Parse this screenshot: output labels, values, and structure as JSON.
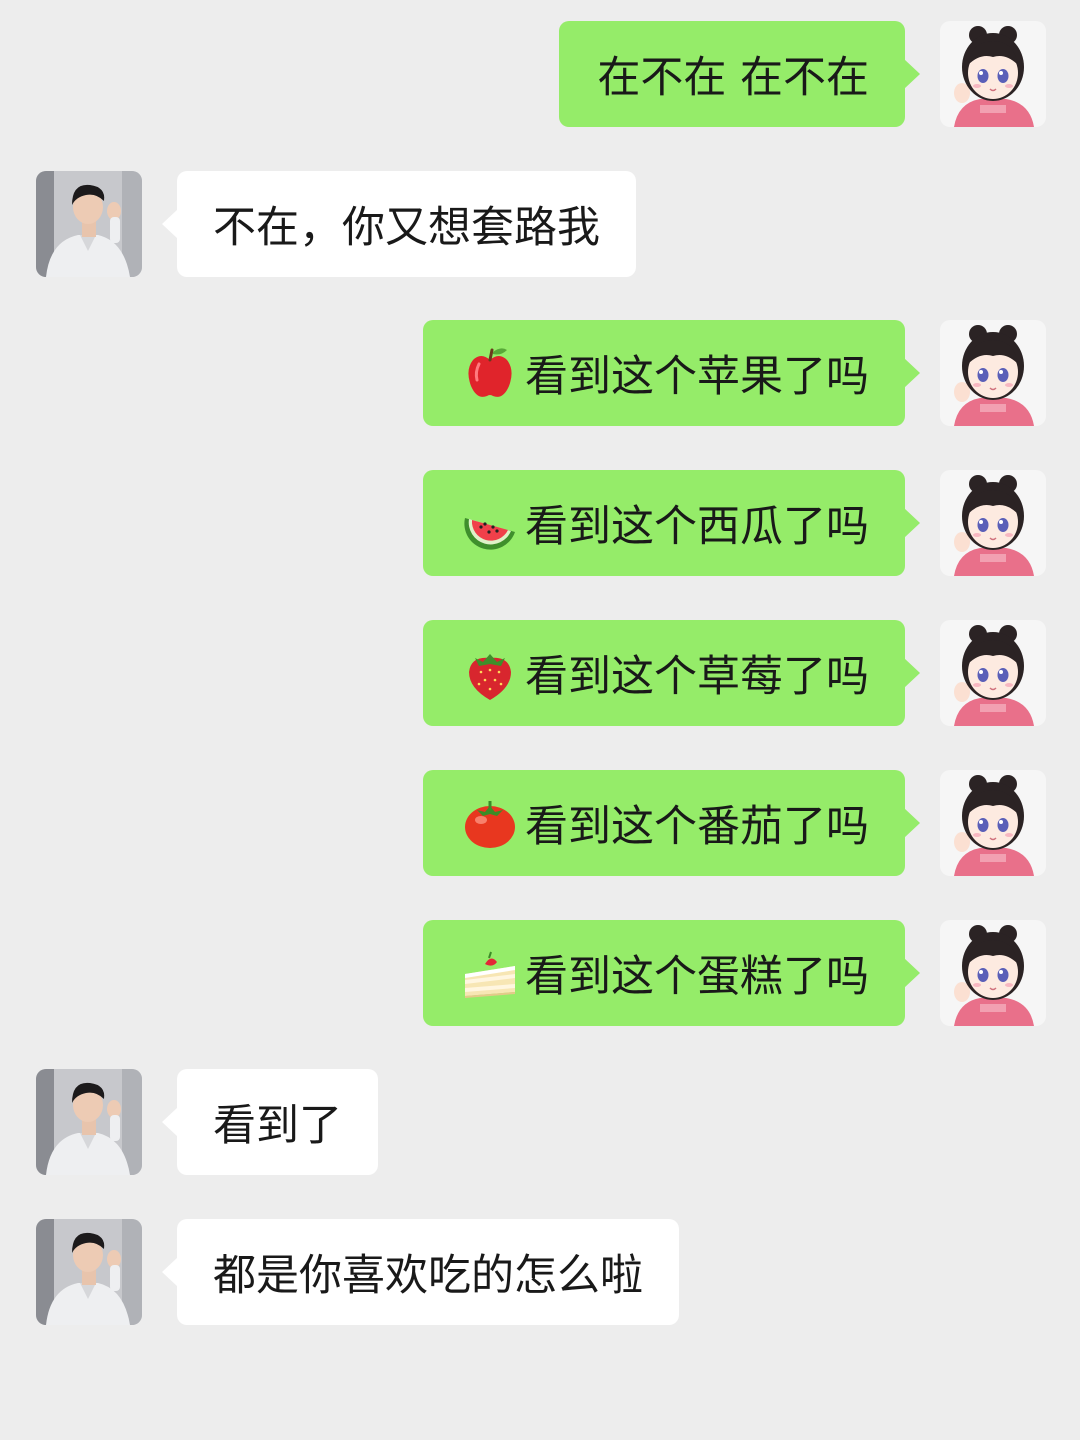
{
  "colors": {
    "background": "#ededed",
    "my_bubble": "#95ec69",
    "their_bubble": "#ffffff",
    "text": "#191919"
  },
  "messages": [
    {
      "sender": "me",
      "text": "在不在 在不在",
      "emoji": null
    },
    {
      "sender": "them",
      "text": "不在，你又想套路我",
      "emoji": null
    },
    {
      "sender": "me",
      "text": "看到这个苹果了吗",
      "emoji": "apple-icon"
    },
    {
      "sender": "me",
      "text": "看到这个西瓜了吗",
      "emoji": "watermelon-icon"
    },
    {
      "sender": "me",
      "text": "看到这个草莓了吗",
      "emoji": "strawberry-icon"
    },
    {
      "sender": "me",
      "text": "看到这个番茄了吗",
      "emoji": "tomato-icon"
    },
    {
      "sender": "me",
      "text": "看到这个蛋糕了吗",
      "emoji": "cake-icon"
    },
    {
      "sender": "them",
      "text": "看到了",
      "emoji": null
    },
    {
      "sender": "them",
      "text": "都是你喜欢吃的怎么啦",
      "emoji": null
    }
  ],
  "avatars": {
    "me": "girl-cartoon-avatar",
    "them": "boy-photo-avatar"
  }
}
